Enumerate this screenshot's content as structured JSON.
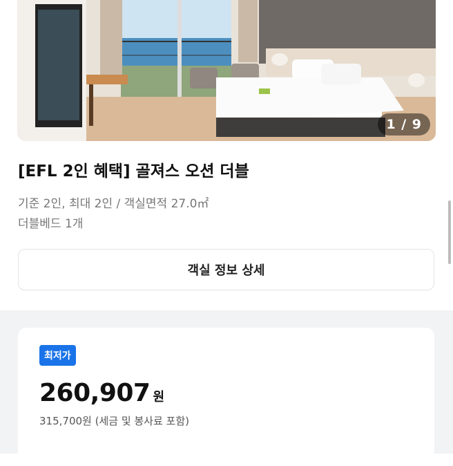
{
  "gallery": {
    "counter": "1 / 9",
    "image_desc": "hotel-room-photo"
  },
  "room": {
    "title": "[EFL 2인 혜택] 골져스 오션 더블",
    "capacity": "기준 2인, 최대 2인 / 객실면적 27.0㎡",
    "bed": "더블베드 1개",
    "detail_button": "객실 정보 상세"
  },
  "price": {
    "badge": "최저가",
    "amount": "260,907",
    "unit": "원",
    "original": "315,700원 (세금 및 봉사료 포함)"
  },
  "colors": {
    "accent": "#1a73e8",
    "section_bg": "#f2f3f5"
  }
}
